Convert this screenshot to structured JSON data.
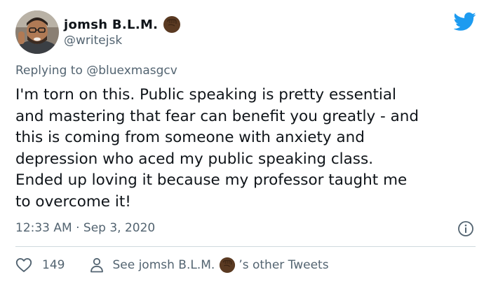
{
  "author": {
    "display_name": "jomsh B.L.M.",
    "handle": "@writejsk"
  },
  "reply_context": {
    "prefix": "Replying to",
    "handle": "@bluexmasgcv"
  },
  "tweet": {
    "lines": [
      "I'm torn on this. Public speaking is pretty essential",
      "and mastering that fear can benefit you greatly - and",
      "this is coming from someone with anxiety and",
      "depression who aced my public speaking class.",
      "Ended up loving it because my professor taught me",
      "to overcome it!"
    ],
    "timestamp": "12:33 AM · Sep 3, 2020"
  },
  "actions": {
    "like_count": "149",
    "profile_link_prefix": "See jomsh B.L.M.",
    "profile_link_suffix": "’s other Tweets"
  },
  "icons": {
    "brand": "twitter-bird-icon",
    "emoji": "raised-fist-emoji",
    "info": "info-icon",
    "like": "heart-icon",
    "profile": "person-icon"
  },
  "colors": {
    "brand_blue": "#1d9bf0",
    "text_primary": "#0f1419",
    "text_secondary": "#536471",
    "divider": "#cfd9de",
    "fist_brown": "#5a3a22"
  }
}
